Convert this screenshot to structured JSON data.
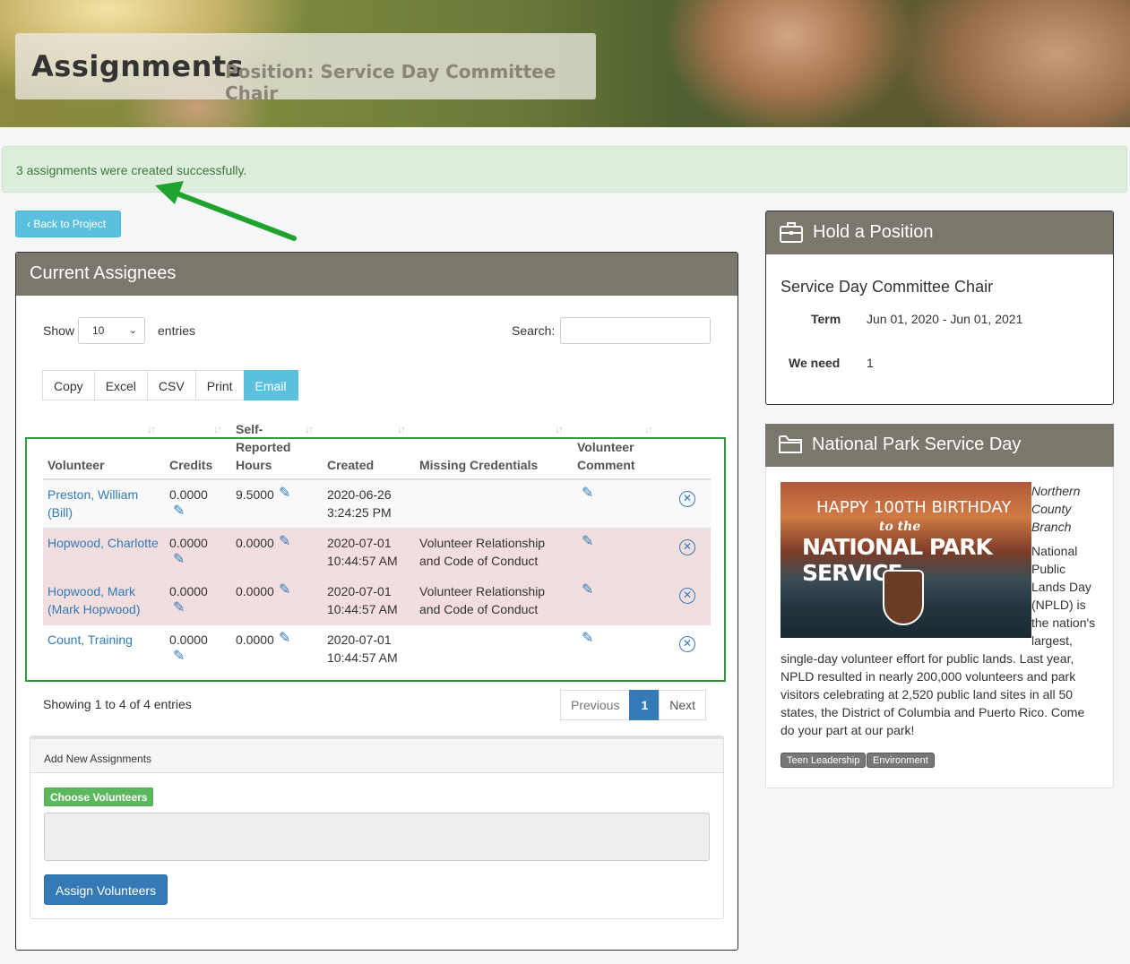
{
  "header": {
    "title": "Assignments",
    "subtitle": "Position: Service Day Committee Chair"
  },
  "alert": {
    "message": "3 assignments were created successfully."
  },
  "back_button": {
    "label": "Back to Project"
  },
  "assignees": {
    "panel_title": "Current Assignees",
    "show_label": "Show",
    "page_size": "10",
    "entries_label": "entries",
    "search_label": "Search:",
    "export_buttons": [
      "Copy",
      "Excel",
      "CSV",
      "Print",
      "Email"
    ],
    "columns": {
      "volunteer": "Volunteer",
      "credits": "Credits",
      "hours_1": "Self-",
      "hours_2": "Reported",
      "hours_3": "Hours",
      "created": "Created",
      "missing": "Missing Credentials",
      "comment_1": "Volunteer",
      "comment_2": "Comment"
    },
    "rows": [
      {
        "name_1": "Preston, William",
        "name_2": "(Bill)",
        "credits": "0.0000",
        "hours": "9.5000",
        "created_1": "2020-06-26",
        "created_2": "3:24:25 PM",
        "missing_1": "",
        "missing_2": ""
      },
      {
        "name_1": "Hopwood, Charlotte",
        "name_2": "",
        "credits": "0.0000",
        "hours": "0.0000",
        "created_1": "2020-07-01",
        "created_2": "10:44:57 AM",
        "missing_1": "Volunteer Relationship",
        "missing_2": "and Code of Conduct"
      },
      {
        "name_1": "Hopwood, Mark",
        "name_2": "(Mark Hopwood)",
        "credits": "0.0000",
        "hours": "0.0000",
        "created_1": "2020-07-01",
        "created_2": "10:44:57 AM",
        "missing_1": "Volunteer Relationship",
        "missing_2": "and Code of Conduct"
      },
      {
        "name_1": "Count, Training",
        "name_2": "",
        "credits": "0.0000",
        "hours": "0.0000",
        "created_1": "2020-07-01",
        "created_2": "10:44:57 AM",
        "missing_1": "",
        "missing_2": ""
      }
    ],
    "showing_text": "Showing 1 to 4 of 4 entries",
    "pager": {
      "previous": "Previous",
      "current": "1",
      "next": "Next"
    }
  },
  "add_assignments": {
    "title": "Add New Assignments",
    "choose_label": "Choose Volunteers",
    "assign_label": "Assign Volunteers"
  },
  "hold_position": {
    "title": "Hold a Position",
    "position_name": "Service Day Committee Chair",
    "term_label": "Term",
    "term_value": "Jun 01, 2020 - Jun 01, 2021",
    "need_label": "We need",
    "need_value": "1"
  },
  "project": {
    "title": "National Park Service Day",
    "image_text_1": "HAPPY 100TH BIRTHDAY",
    "image_text_2": "to the",
    "image_text_3": "NATIONAL PARK SERVICE",
    "branch_1": "Northern",
    "branch_2": "County",
    "branch_3": "Branch",
    "desc_lines_side": [
      "National",
      "Public",
      "Lands Day",
      "(NPLD) is",
      "the nation's",
      "largest,"
    ],
    "desc_lines_full": [
      "single-day volunteer effort for public lands. Last year,",
      "NPLD resulted in nearly 200,000 volunteers and park",
      "visitors celebrating at 2,520 public land sites in all 50",
      "states, the District of Columbia and Puerto Rico. Come",
      "do your part at our park!"
    ],
    "tags": [
      "Teen Leadership",
      "Environment"
    ]
  }
}
